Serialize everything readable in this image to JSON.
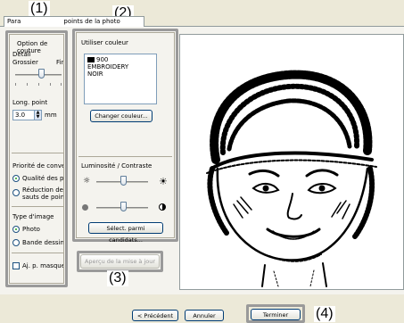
{
  "callouts": {
    "c1": "(1)",
    "c2": "(2)",
    "c3": "(3)",
    "c4": "(4)"
  },
  "tab": {
    "left": "Para",
    "right": "points de la photo"
  },
  "left_panel": {
    "option_couture": "Option de couture",
    "detail": "Détail",
    "grossier": "Grossier",
    "fin": "Fin",
    "long_point": "Long. point",
    "long_point_value": "3.0",
    "mm": "mm",
    "priorite": "Priorité de conversi",
    "radio_qualite": "Qualité des poir",
    "radio_reduction_1": "Réduction des",
    "radio_reduction_2": "sauts de points",
    "type_image": "Type d'image",
    "radio_photo": "Photo",
    "radio_bande": "Bande dessinée",
    "aj_masque": "Aj. p. masque"
  },
  "middle_panel": {
    "utiliser_couleur": "Utiliser couleur",
    "color_list": {
      "code": "900",
      "line1": "EMBROIDERY",
      "line2": "NOIR"
    },
    "swatch_color": "#000000",
    "changer_couleur": "Changer couleur...",
    "luminosite": "Luminosité / Contraste",
    "select_candidats": "Sélect. parmi candidats..."
  },
  "apercu_button": "Aperçu de la mise à jour",
  "footer": {
    "precedent": "< Précédent",
    "annuler": "Annuler",
    "terminer": "Terminer"
  }
}
